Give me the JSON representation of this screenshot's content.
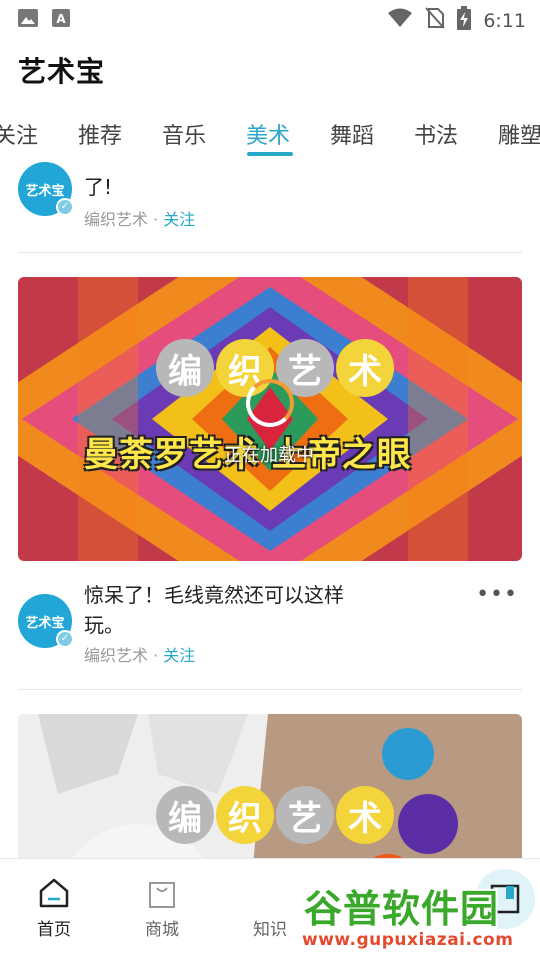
{
  "status_bar": {
    "time": "6:11"
  },
  "app": {
    "title": "艺术宝"
  },
  "tabs": [
    {
      "label": "关注"
    },
    {
      "label": "推荐"
    },
    {
      "label": "音乐"
    },
    {
      "label": "美术",
      "active": true
    },
    {
      "label": "舞蹈"
    },
    {
      "label": "书法"
    },
    {
      "label": "雕塑"
    }
  ],
  "posts": [
    {
      "title_line2": "了!",
      "author": "编织艺术",
      "follow": "关注",
      "avatar_text": "艺术宝"
    },
    {
      "video": {
        "bubbles": [
          "编",
          "织",
          "艺",
          "术"
        ],
        "caption": "曼荼罗艺术 上帝之眼",
        "loading": "正在加载中"
      },
      "title_line1": "惊呆了！毛线竟然还可以这样",
      "title_line2": "玩。",
      "author": "编织艺术",
      "follow": "关注",
      "avatar_text": "艺术宝",
      "more": "•••"
    },
    {
      "video": {
        "bubbles": [
          "编",
          "织",
          "艺",
          "术"
        ]
      }
    }
  ],
  "bottom_nav": [
    {
      "label": "首页",
      "icon": "home-icon",
      "active": true
    },
    {
      "label": "商城",
      "icon": "shop-bag-icon"
    },
    {
      "label": "知识",
      "icon": "knowledge-icon"
    }
  ],
  "watermark": {
    "main": "谷普软件园",
    "sub": "www.gupuxiazai.com"
  },
  "colors": {
    "accent": "#29a7c9",
    "avatar": "#21a6d7",
    "caption": "#ffe74a",
    "watermark_green": "#3aa82a",
    "watermark_red": "#e34a2e"
  }
}
